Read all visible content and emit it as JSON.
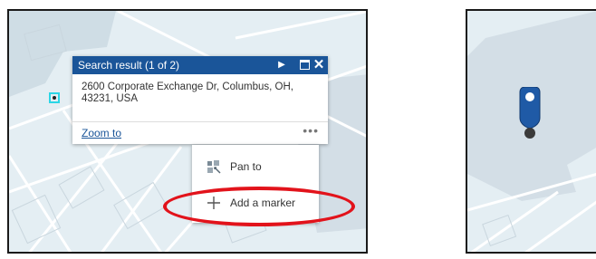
{
  "popup": {
    "title": "Search result (1 of 2)",
    "next_icon": "next-arrow-icon",
    "maximize_icon": "maximize-icon",
    "close_icon": "close-icon",
    "address_line1": "2600 Corporate Exchange Dr, Columbus, OH,",
    "address_line2": "43231, USA",
    "zoom_link": "Zoom to",
    "more_label": "•••"
  },
  "context_menu": {
    "items": [
      {
        "label": "Pan to",
        "icon": "pan-icon"
      },
      {
        "label": "Add a marker",
        "icon": "plus-icon"
      }
    ]
  },
  "colors": {
    "header": "#1a5599",
    "highlight": "#e2131b",
    "map_bg": "#e4eef3",
    "marker_outline": "#2bd6e6",
    "pin": "#1f5aa6"
  }
}
